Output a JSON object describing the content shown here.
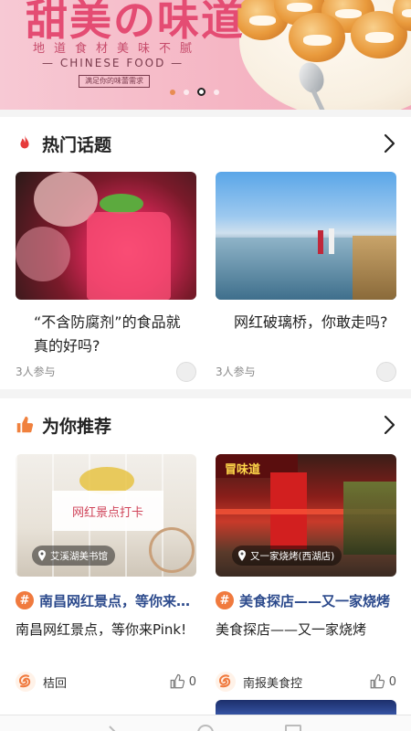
{
  "banner": {
    "title": "甜美の味道",
    "subtitle": "地道食材美味不腻",
    "english": "— CHINESE FOOD —",
    "tag": "满足你的味蕾需求",
    "indicator_count": 4,
    "active_index": 2
  },
  "hot_topics": {
    "title": "热门话题",
    "icon": "flame-icon",
    "cards": [
      {
        "title": "“不含防腐剂”的食品就真的好吗?",
        "participants": "3人参与"
      },
      {
        "title": "网红破璃桥，你敢走吗?",
        "participants": "3人参与"
      }
    ]
  },
  "recommend": {
    "title": "为你推荐",
    "icon": "thumbs-up-icon",
    "cards": [
      {
        "image_caption": "网红景点打卡",
        "location": "艾溪湖美书馆",
        "topic": "南昌网红景点，等你来Pink!",
        "description": "南昌网红景点，等你来Pink!",
        "author": "桔回",
        "likes": "0"
      },
      {
        "image_caption": "",
        "location": "又一家烧烤(西湖店)",
        "topic": "美食探店——又一家烧烤",
        "description": "美食探店——又一家烧烤",
        "author": "南报美食控",
        "likes": "0"
      }
    ]
  },
  "colors": {
    "accent": "#f07a3e",
    "topic_text": "#2c4a8c",
    "flame": "#e63b3b",
    "thumb": "#f0813e",
    "banner_pink": "#e44c73"
  }
}
